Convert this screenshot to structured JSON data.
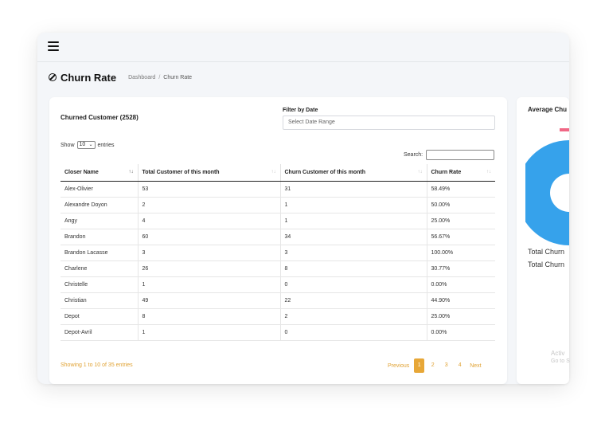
{
  "header": {
    "menu_icon": "hamburger-icon"
  },
  "page": {
    "title": "Churn Rate",
    "title_icon": "ban-icon",
    "breadcrumb": {
      "home": "Dashboard",
      "separator": "/",
      "current": "Churn Rate"
    }
  },
  "card": {
    "title": "Churned Customer (2528)",
    "filter": {
      "label": "Filter by Date",
      "placeholder": "Select Date Range"
    },
    "length": {
      "show": "Show",
      "value": "10",
      "entries": "entries"
    },
    "search": {
      "label": "Search:",
      "value": ""
    }
  },
  "table": {
    "columns": [
      "Closer Name",
      "Total Customer of this month",
      "Churn Customer of this month",
      "Churn Rate"
    ],
    "rows": [
      [
        "Alex-Olivier",
        "53",
        "31",
        "58.49%"
      ],
      [
        "Alexandre Doyon",
        "2",
        "1",
        "50.00%"
      ],
      [
        "Angy",
        "4",
        "1",
        "25.00%"
      ],
      [
        "Brandon",
        "60",
        "34",
        "56.67%"
      ],
      [
        "Brandon Lacasse",
        "3",
        "3",
        "100.00%"
      ],
      [
        "Charlene",
        "26",
        "8",
        "30.77%"
      ],
      [
        "Christelle",
        "1",
        "0",
        "0.00%"
      ],
      [
        "Christian",
        "49",
        "22",
        "44.90%"
      ],
      [
        "Depot",
        "8",
        "2",
        "25.00%"
      ],
      [
        "Depot-Avril",
        "1",
        "0",
        "0.00%"
      ]
    ]
  },
  "pagination": {
    "info": "Showing 1 to 10 of 35 entries",
    "previous": "Previous",
    "pages": [
      "1",
      "2",
      "3",
      "4"
    ],
    "current": "1",
    "next": "Next"
  },
  "side_panel": {
    "title": "Average Chu",
    "stat_1": "Total Churn",
    "stat_2": "Total Churn",
    "watermark_1": "Activ",
    "watermark_2": "Go to S"
  },
  "colors": {
    "accent": "#e7a737",
    "link": "#2f7fd6",
    "donut": "#36a2eb",
    "legend": "#f06785"
  }
}
